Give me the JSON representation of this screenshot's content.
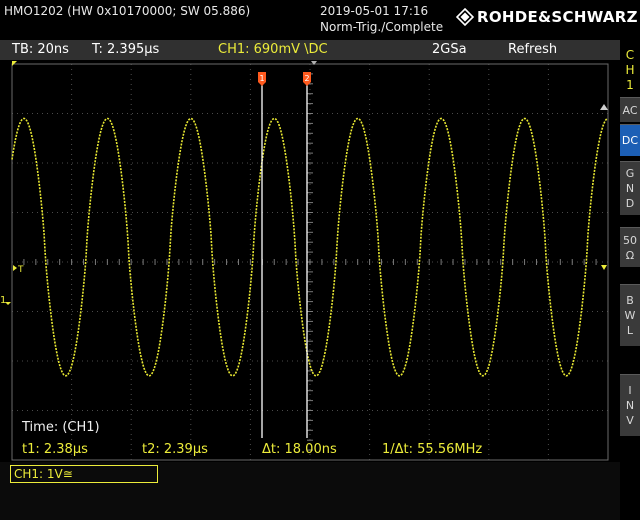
{
  "title_bar": {
    "device_info": "HMO1202 (HW 0x10170000; SW 05.886)",
    "timestamp": "2019-05-01 17:16",
    "trigger_status": "Norm-Trig./Complete",
    "brand": "ROHDE&SCHWARZ",
    "brand_logo_icon": "rohde-schwarz-diamond-icon"
  },
  "settings": {
    "timebase": "TB: 20ns",
    "trigger_time": "T: 2.395µs",
    "channel_setting": "CH1: 690mV \\DC",
    "sample_rate": "2GSa",
    "acquisition_mode": "Refresh"
  },
  "side_panel": {
    "channel_label": [
      "C",
      "H",
      "1"
    ],
    "buttons": {
      "ac": "AC",
      "dc": "DC",
      "gnd": [
        "G",
        "N",
        "D"
      ],
      "fifty": [
        "50",
        "Ω"
      ],
      "bwl": [
        "B",
        "W",
        "L"
      ],
      "inv": [
        "I",
        "N",
        "V"
      ]
    },
    "active_button": "dc"
  },
  "cursor_markers": {
    "cursor1_label": "1",
    "cursor2_label": "2",
    "channel_marker_label": "1",
    "trigger_level_label": "T"
  },
  "readout": {
    "title": "Time: (CH1)",
    "t1": "t1: 2.38µs",
    "t2": "t2: 2.39µs",
    "delta_t": "Δt: 18.00ns",
    "frequency": "1/Δt: 55.56MHz"
  },
  "status_bar": {
    "channel_badge": "CH1: 1V≅"
  },
  "colors": {
    "trace": "#e8e832",
    "cursor": "#ffffff",
    "cursor_marker": "#ff5a1e",
    "active_button": "#1c5fb5",
    "grid": "#4a4a4a"
  },
  "waveform": {
    "shape": "sine-like with sharp peaks",
    "cycles_visible": 7,
    "period_divisions": 1.4,
    "amplitude_divisions": 2.6,
    "offset_divisions": 0.3
  }
}
